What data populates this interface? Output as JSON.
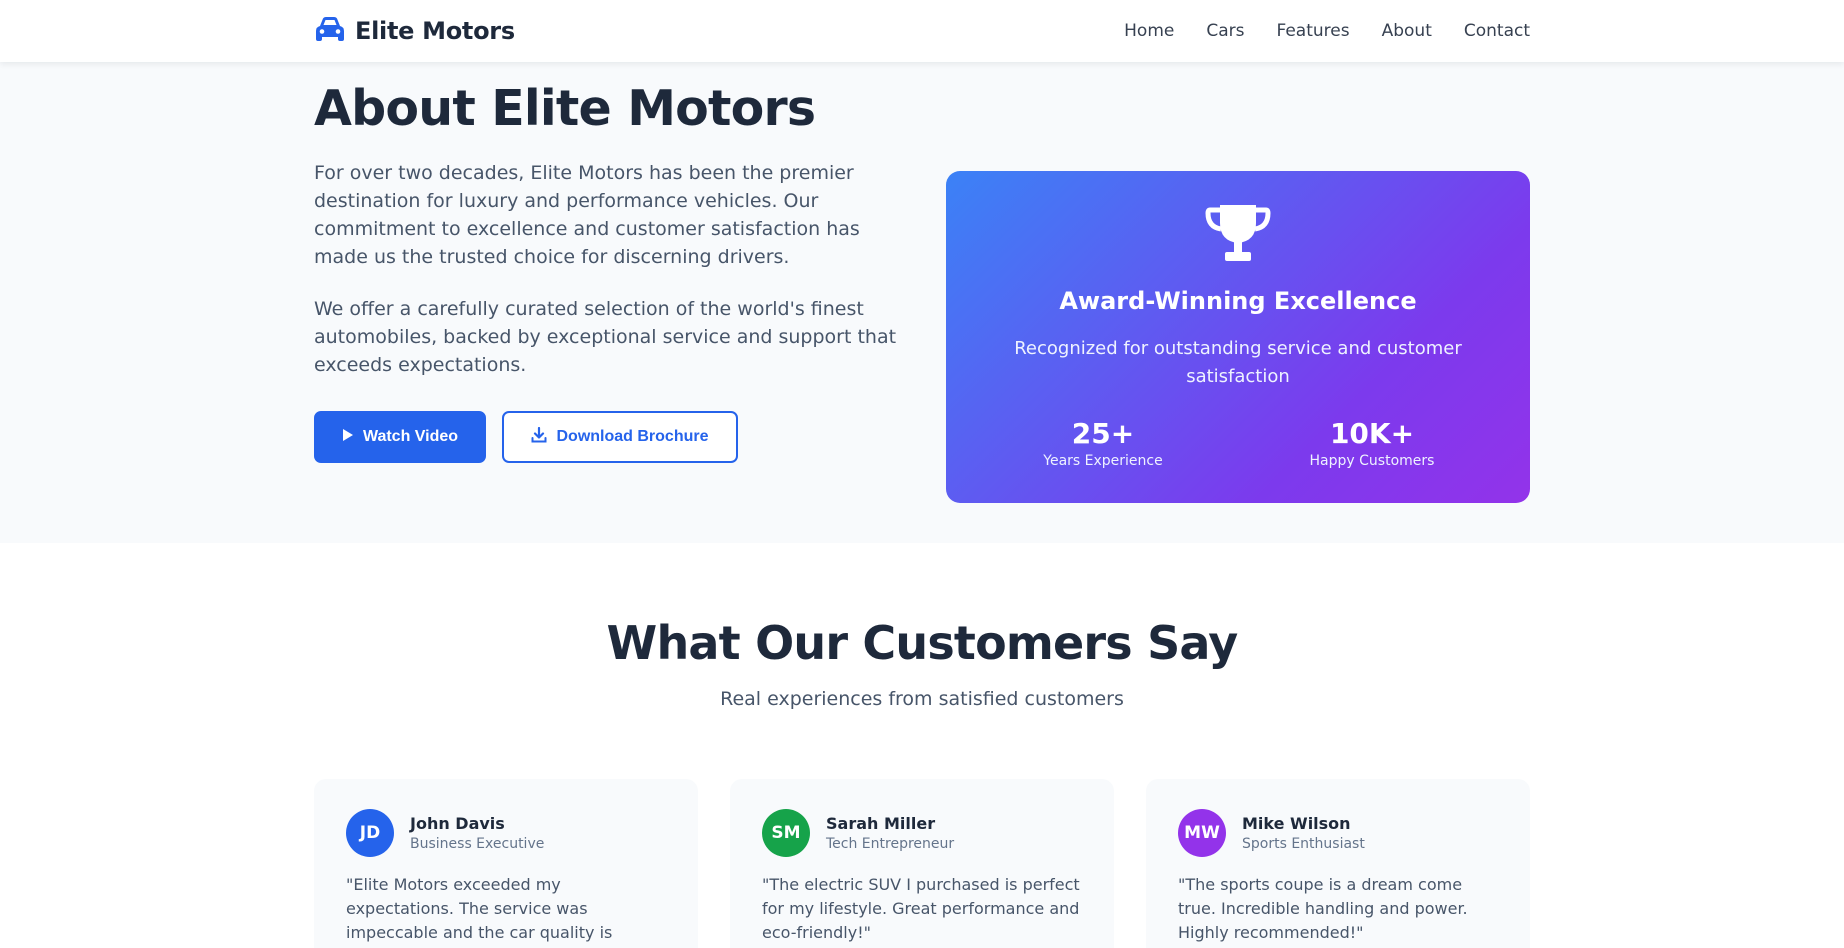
{
  "brand": {
    "name": "Elite Motors",
    "icon": "car-icon",
    "color": "#2563eb"
  },
  "nav": {
    "links": [
      "Home",
      "Cars",
      "Features",
      "About",
      "Contact"
    ]
  },
  "about": {
    "title": "About Elite Motors",
    "paragraph1": "For over two decades, Elite Motors has been the premier destination for luxury and performance vehicles. Our commitment to excellence and customer satisfaction has made us the trusted choice for discerning drivers.",
    "paragraph2": "We offer a carefully curated selection of the world's finest automobiles, backed by exceptional service and support that exceeds expectations.",
    "watch_video_label": "Watch Video",
    "watch_video_icon": "play-icon",
    "download_label": "Download Brochure",
    "download_icon": "download-icon"
  },
  "award": {
    "icon": "trophy-icon",
    "title": "Award-Winning Excellence",
    "description": "Recognized for outstanding service and customer satisfaction",
    "stats": [
      {
        "value": "25+",
        "label": "Years Experience"
      },
      {
        "value": "10K+",
        "label": "Happy Customers"
      }
    ],
    "gradient_colors": [
      "#3b82f6",
      "#7c3aed",
      "#9333ea"
    ]
  },
  "testimonials": {
    "title": "What Our Customers Say",
    "subtitle": "Real experiences from satisfied customers",
    "items": [
      {
        "initials": "JD",
        "name": "John Davis",
        "role": "Business Executive",
        "quote": "\"Elite Motors exceeded my expectations. The service was impeccable and the car quality is outstanding.\"",
        "color": "#2563eb"
      },
      {
        "initials": "SM",
        "name": "Sarah Miller",
        "role": "Tech Entrepreneur",
        "quote": "\"The electric SUV I purchased is perfect for my lifestyle. Great performance and eco-friendly!\"",
        "color": "#16a34a"
      },
      {
        "initials": "MW",
        "name": "Mike Wilson",
        "role": "Sports Enthusiast",
        "quote": "\"The sports coupe is a dream come true. Incredible handling and power. Highly recommended!\"",
        "color": "#9333ea"
      }
    ]
  }
}
